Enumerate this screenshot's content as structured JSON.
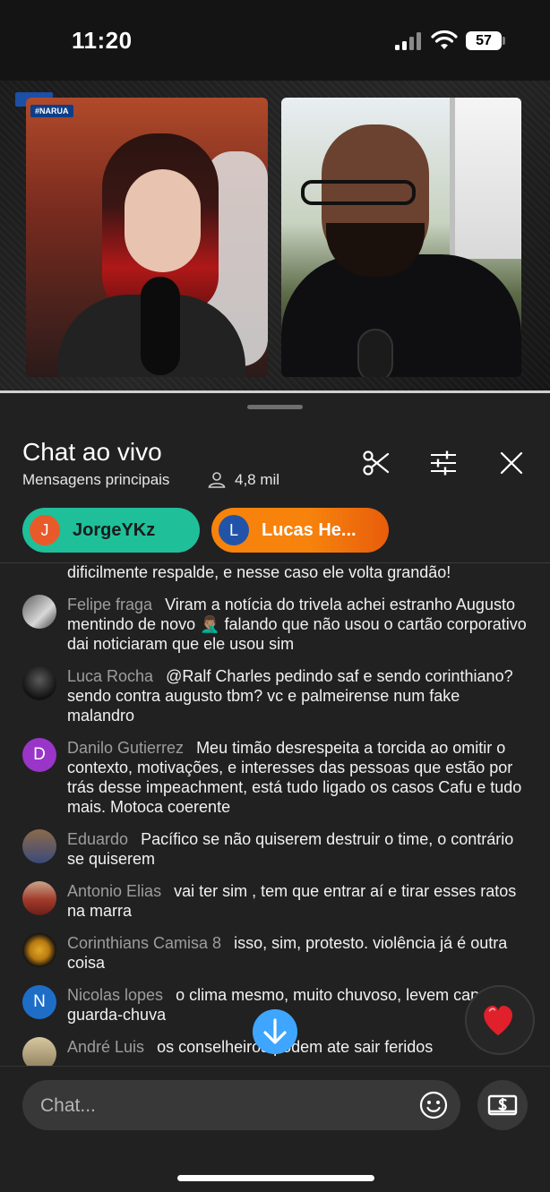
{
  "status_bar": {
    "time": "11:20",
    "battery": "57"
  },
  "video": {
    "tag": "#NARUA"
  },
  "chat": {
    "title": "Chat ao vivo",
    "subtitle": "Mensagens principais",
    "viewers": "4,8 mil",
    "pinned": [
      {
        "initial": "J",
        "name": "JorgeYKz"
      },
      {
        "initial": "L",
        "name": "Lucas He..."
      }
    ],
    "messages": [
      {
        "author": "",
        "text": "dificilmente respalde, e nesse caso ele volta grandão!",
        "avatar": ""
      },
      {
        "author": "Felipe fraga",
        "text": "Viram a notícia do trivela achei estranho Augusto mentindo de novo 🤦🏽‍♂️ falando que não usou o cartão corporativo dai noticiaram que ele usou sim",
        "avatar": ""
      },
      {
        "author": "Luca Rocha",
        "text": "@Ralf Charles pedindo saf e sendo corinthiano? sendo contra augusto tbm? vc e palmeirense num fake malandro",
        "avatar": ""
      },
      {
        "author": "Danilo Gutierrez",
        "text": "Meu timão desrespeita a torcida ao omitir o contexto, motivações, e interesses das pessoas que estão por trás desse impeachment, está tudo ligado os casos Cafu e tudo mais. Motoca coerente",
        "avatar": "D"
      },
      {
        "author": "Eduardo",
        "text": "Pacífico se não quiserem destruir o time, o contrário se quiserem",
        "avatar": ""
      },
      {
        "author": "Antonio Elias",
        "text": "vai ter sim , tem que entrar aí e tirar esses ratos na marra",
        "avatar": ""
      },
      {
        "author": "Corinthians Camisa 8",
        "text": "isso, sim, protesto. violência já é outra coisa",
        "avatar": ""
      },
      {
        "author": "Nicolas lopes",
        "text": "o clima mesmo, muito chuvoso, levem capas guarda-chuva",
        "avatar": "N"
      },
      {
        "author": "André Luis",
        "text": "os conselheiros podem ate sair feridos",
        "avatar": ""
      }
    ],
    "input_placeholder": "Chat...",
    "heart": "❤️"
  }
}
